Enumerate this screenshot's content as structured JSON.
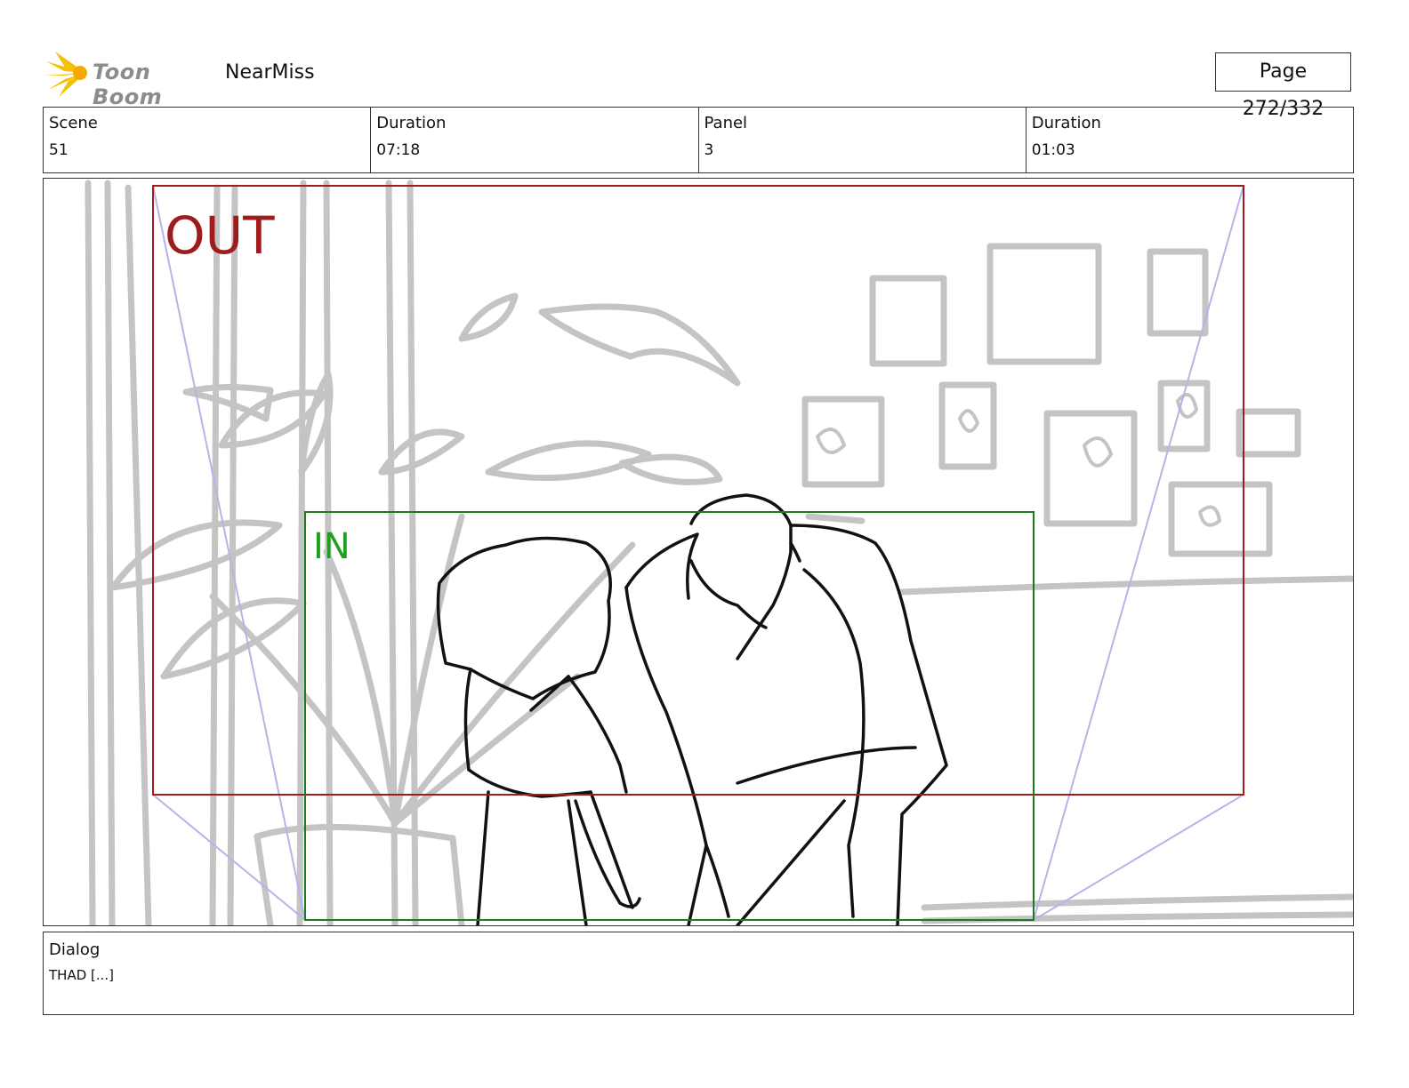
{
  "header": {
    "logo_text": "Toon Boom",
    "project_title": "NearMiss",
    "page_label": "Page 272/332"
  },
  "info": {
    "scene_label": "Scene",
    "scene_value": "51",
    "scene_duration_label": "Duration",
    "scene_duration_value": "07:18",
    "panel_label": "Panel",
    "panel_value": "3",
    "panel_duration_label": "Duration",
    "panel_duration_value": "01:03"
  },
  "panel": {
    "out_label": "OUT",
    "in_label": "IN",
    "out_color": "#a01c1c",
    "in_color": "#1e7a1e",
    "guide_color": "#b8b2e8",
    "background_sketch_color": "#c4c4c4"
  },
  "dialog": {
    "label": "Dialog",
    "text": "THAD [...]"
  }
}
